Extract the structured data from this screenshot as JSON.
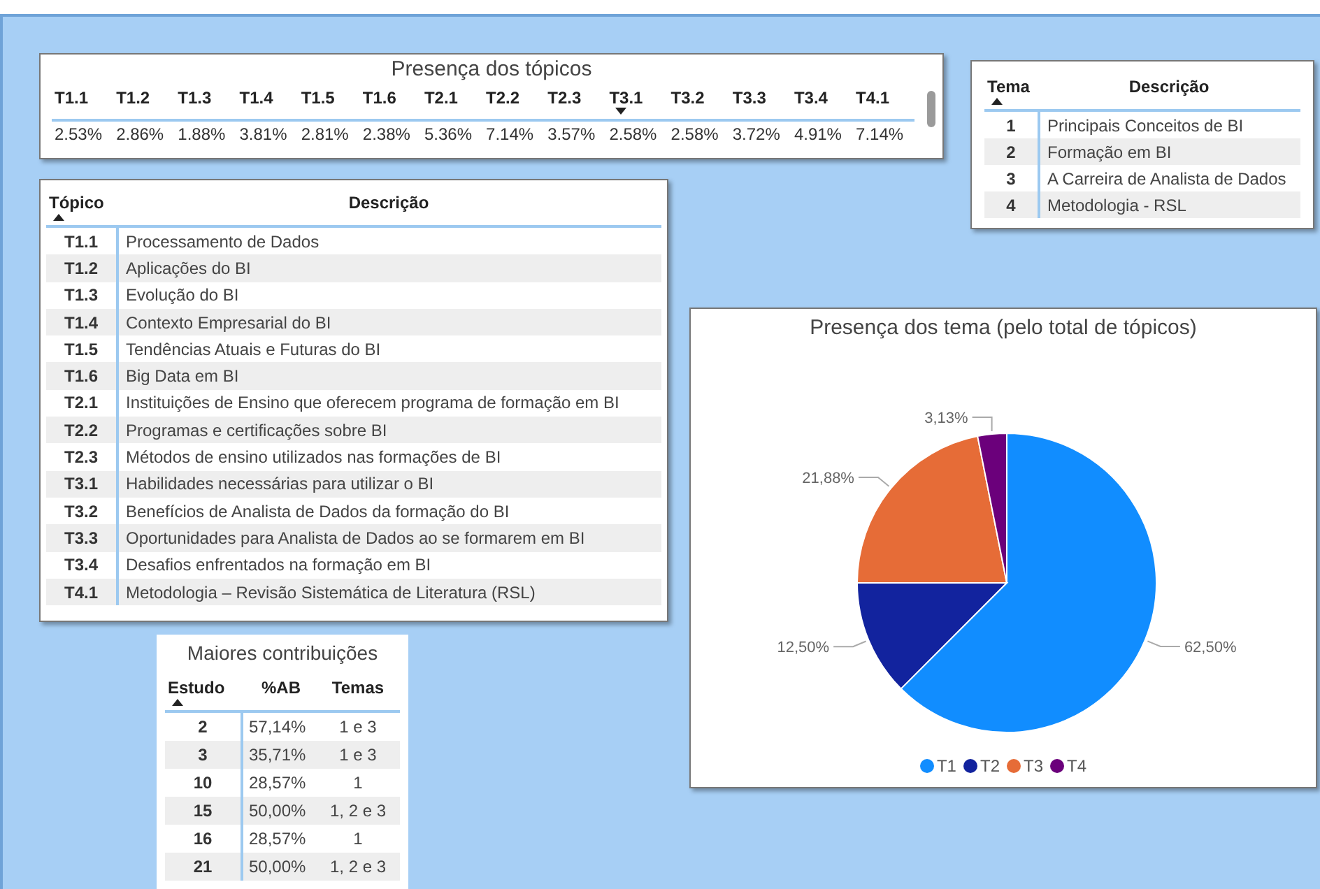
{
  "topic_presence": {
    "title": "Presença dos tópicos",
    "descending": true,
    "columns": [
      {
        "label": "T1.1",
        "value": "2.53%",
        "sorted": false
      },
      {
        "label": "T1.2",
        "value": "2.86%",
        "sorted": false
      },
      {
        "label": "T1.3",
        "value": "1.88%",
        "sorted": false
      },
      {
        "label": "T1.4",
        "value": "3.81%",
        "sorted": false
      },
      {
        "label": "T1.5",
        "value": "2.81%",
        "sorted": false
      },
      {
        "label": "T1.6",
        "value": "2.38%",
        "sorted": false
      },
      {
        "label": "T2.1",
        "value": "5.36%",
        "sorted": false
      },
      {
        "label": "T2.2",
        "value": "7.14%",
        "sorted": false
      },
      {
        "label": "T2.3",
        "value": "3.57%",
        "sorted": false
      },
      {
        "label": "T3.1",
        "value": "2.58%",
        "sorted": true
      },
      {
        "label": "T3.2",
        "value": "2.58%",
        "sorted": false
      },
      {
        "label": "T3.3",
        "value": "3.72%",
        "sorted": false
      },
      {
        "label": "T3.4",
        "value": "4.91%",
        "sorted": false
      },
      {
        "label": "T4.1",
        "value": "7.14%",
        "sorted": false
      }
    ]
  },
  "themes_table": {
    "descending": false,
    "columns": [
      {
        "label": "Tema",
        "sorted": true
      },
      {
        "label": "Descrição",
        "sorted": false
      }
    ],
    "rows": [
      [
        "1",
        "Principais Conceitos de BI"
      ],
      [
        "2",
        "Formação em BI"
      ],
      [
        "3",
        "A Carreira de Analista de Dados"
      ],
      [
        "4",
        "Metodologia - RSL"
      ]
    ]
  },
  "topics_table": {
    "descending": false,
    "columns": [
      {
        "label": "Tópico",
        "sorted": true
      },
      {
        "label": "Descrição",
        "sorted": false
      }
    ],
    "rows": [
      [
        "T1.1",
        "Processamento de Dados"
      ],
      [
        "T1.2",
        "Aplicações do BI"
      ],
      [
        "T1.3",
        "Evolução do BI"
      ],
      [
        "T1.4",
        "Contexto Empresarial do BI"
      ],
      [
        "T1.5",
        "Tendências Atuais e Futuras do BI"
      ],
      [
        "T1.6",
        "Big Data em BI"
      ],
      [
        "T2.1",
        "Instituições de Ensino que oferecem programa de formação em BI"
      ],
      [
        "T2.2",
        "Programas e certificações sobre BI"
      ],
      [
        "T2.3",
        "Métodos de ensino utilizados nas formações de BI"
      ],
      [
        "T3.1",
        "Habilidades necessárias para utilizar o BI"
      ],
      [
        "T3.2",
        "Benefícios de Analista de Dados da formação do BI"
      ],
      [
        "T3.3",
        "Oportunidades para Analista de Dados ao se formarem em BI"
      ],
      [
        "T3.4",
        "Desafios enfrentados na formação em BI"
      ],
      [
        "T4.1",
        "Metodologia – Revisão Sistemática de Literatura (RSL)"
      ]
    ]
  },
  "contributions_table": {
    "title": "Maiores contribuições",
    "descending": false,
    "columns": [
      {
        "label": "Estudo",
        "sorted": true
      },
      {
        "label": "%AB",
        "sorted": false
      },
      {
        "label": "Temas",
        "sorted": false
      }
    ],
    "rows": [
      [
        "2",
        "57,14%",
        "1 e 3"
      ],
      [
        "3",
        "35,71%",
        "1 e 3"
      ],
      [
        "10",
        "28,57%",
        "1"
      ],
      [
        "15",
        "50,00%",
        "1, 2 e 3"
      ],
      [
        "16",
        "28,57%",
        "1"
      ],
      [
        "21",
        "50,00%",
        "1, 2 e 3"
      ]
    ]
  },
  "theme_chart": {
    "chart_data": {
      "type": "pie",
      "title": "Presença dos tema (pelo total de tópicos)",
      "categories": [
        "T1",
        "T2",
        "T3",
        "T4"
      ],
      "series": [
        {
          "values": [
            62.5,
            12.5,
            21.88,
            3.13
          ]
        }
      ],
      "colors": [
        "#118dff",
        "#12239e",
        "#e66c37",
        "#6b007b"
      ],
      "value_labels": [
        "62,50%",
        "12,50%",
        "21,88%",
        "3,13%"
      ]
    }
  }
}
